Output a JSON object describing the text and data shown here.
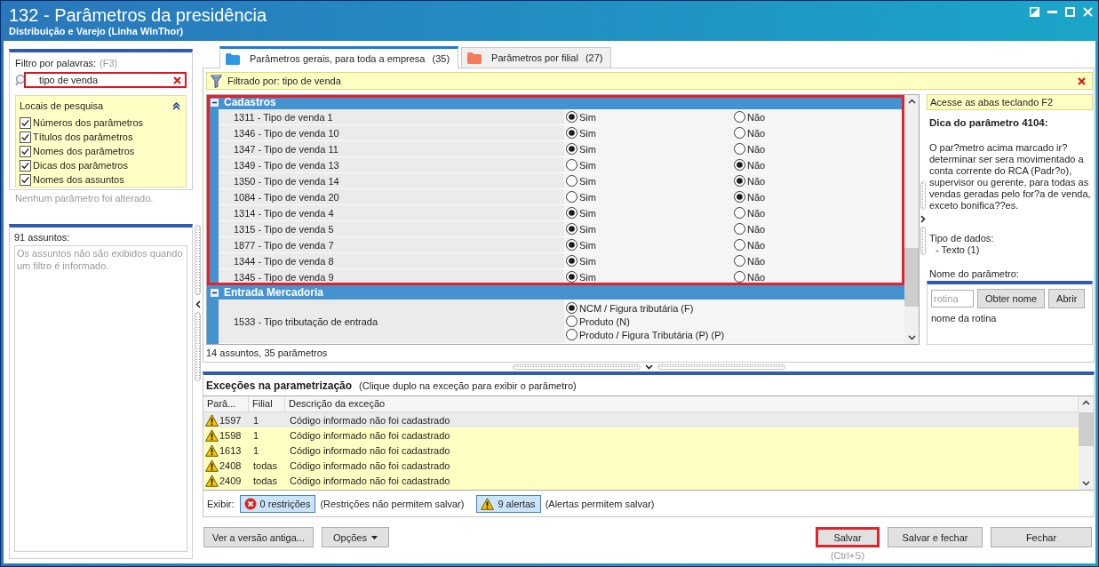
{
  "window": {
    "title": "132 - Parâmetros da presidência",
    "subtitle": "Distribuição e Varejo (Linha WinThor)"
  },
  "filter_panel": {
    "label": "Filtro por palavras:",
    "shortcut": "(F3)",
    "search": {
      "value": "tipo de venda",
      "highlighted": true
    },
    "search_locations": {
      "title": "Locais de pesquisa",
      "expanded": true,
      "options": [
        {
          "label": "Números dos parâmetros",
          "checked": true
        },
        {
          "label": "Títulos dos parâmetros",
          "checked": true
        },
        {
          "label": "Nomes dos parâmetros",
          "checked": true
        },
        {
          "label": "Dicas dos parâmetros",
          "checked": true
        },
        {
          "label": "Nomes dos assuntos",
          "checked": true
        }
      ]
    },
    "status": "Nenhum parâmetro foi alterado."
  },
  "subjects_panel": {
    "title": "91 assuntos:",
    "message": "Os assuntos não são exibidos quando um filtro é informado."
  },
  "tabs": [
    {
      "label": "Parâmetros gerais, para toda a empresa",
      "count": "(35)",
      "color": "#2b98e4",
      "selected": true
    },
    {
      "label": "Parâmetros por filial",
      "count": "(27)",
      "color": "#f47c5c",
      "selected": false
    }
  ],
  "filter_bar": {
    "text": "Filtrado por: tipo de venda"
  },
  "groups": [
    {
      "title": "Cadastros",
      "expanded": true,
      "highlighted": true,
      "rows": [
        {
          "label": "1311 - Tipo de venda 1",
          "kind": "inline",
          "options": [
            {
              "label": "Sim",
              "selected": true
            },
            {
              "label": "Não",
              "selected": false
            }
          ]
        },
        {
          "label": "1346 - Tipo de venda 10",
          "kind": "inline",
          "options": [
            {
              "label": "Sim",
              "selected": true
            },
            {
              "label": "Não",
              "selected": false
            }
          ]
        },
        {
          "label": "1347 - Tipo de venda 11",
          "kind": "inline",
          "options": [
            {
              "label": "Sim",
              "selected": true
            },
            {
              "label": "Não",
              "selected": false
            }
          ]
        },
        {
          "label": "1349 - Tipo de venda 13",
          "kind": "inline",
          "options": [
            {
              "label": "Sim",
              "selected": false
            },
            {
              "label": "Não",
              "selected": true
            }
          ]
        },
        {
          "label": "1350 - Tipo de venda 14",
          "kind": "inline",
          "options": [
            {
              "label": "Sim",
              "selected": false
            },
            {
              "label": "Não",
              "selected": true
            }
          ]
        },
        {
          "label": "1084 - Tipo de venda 20",
          "kind": "inline",
          "options": [
            {
              "label": "Sim",
              "selected": false
            },
            {
              "label": "Não",
              "selected": true
            }
          ]
        },
        {
          "label": "1314 - Tipo de venda 4",
          "kind": "inline",
          "options": [
            {
              "label": "Sim",
              "selected": true
            },
            {
              "label": "Não",
              "selected": false
            }
          ]
        },
        {
          "label": "1315 - Tipo de venda 5",
          "kind": "inline",
          "options": [
            {
              "label": "Sim",
              "selected": true
            },
            {
              "label": "Não",
              "selected": false
            }
          ]
        },
        {
          "label": "1877 - Tipo de venda 7",
          "kind": "inline",
          "options": [
            {
              "label": "Sim",
              "selected": true
            },
            {
              "label": "Não",
              "selected": false
            }
          ]
        },
        {
          "label": "1344 - Tipo de venda 8",
          "kind": "inline",
          "options": [
            {
              "label": "Sim",
              "selected": true
            },
            {
              "label": "Não",
              "selected": false
            }
          ]
        },
        {
          "label": "1345 - Tipo de venda 9",
          "kind": "inline",
          "options": [
            {
              "label": "Sim",
              "selected": true
            },
            {
              "label": "Não",
              "selected": false
            }
          ]
        }
      ]
    },
    {
      "title": "Entrada Mercadoria",
      "expanded": true,
      "highlighted": false,
      "rows": [
        {
          "label": "1533 - Tipo tributação de entrada",
          "kind": "stacked",
          "options": [
            {
              "label": "NCM / Figura tributária (F)",
              "selected": true
            },
            {
              "label": "Produto (N)",
              "selected": false
            },
            {
              "label": "Produto / Figura Tributária (P) (P)",
              "selected": false
            }
          ]
        }
      ]
    }
  ],
  "grid_status": "14 assuntos, 35 parâmetros",
  "hint_panel": {
    "banner": "Acesse as abas teclando F2",
    "title": "Dica do parâmetro 4104:",
    "text": "O par?metro acima marcado ir? determinar ser sera movimentado a conta corrente do RCA (Padr?o), supervisor ou gerente, para todas as vendas geradas pelo for?a de venda, exceto bonifica??es.",
    "data_type_label": "Tipo de dados:",
    "data_type": "- Texto (1)",
    "name_label": "Nome do parâmetro:",
    "name_field": {
      "placeholder": "rotina"
    },
    "buttons": [
      "Obter nome",
      "Abrir"
    ],
    "routine_name": "nome da rotina"
  },
  "exceptions": {
    "title": "Exceções na parametrização",
    "hint": "(Clique duplo na exceção para exibir o parâmetro)",
    "columns": [
      "Parâ...",
      "Filial",
      "Descrição da exceção"
    ],
    "rows": [
      {
        "kind": "alert",
        "param": "1597",
        "branch": "1",
        "description": "Código informado não foi cadastrado",
        "selected": true
      },
      {
        "kind": "alert",
        "param": "1598",
        "branch": "1",
        "description": "Código informado não foi cadastrado",
        "selected": false
      },
      {
        "kind": "alert",
        "param": "1613",
        "branch": "1",
        "description": "Código informado não foi cadastrado",
        "selected": false
      },
      {
        "kind": "alert",
        "param": "2408",
        "branch": "todas",
        "description": "Código informado não foi cadastrado",
        "selected": false
      },
      {
        "kind": "alert",
        "param": "2409",
        "branch": "todas",
        "description": "Código informado não foi cadastrado",
        "selected": false
      }
    ],
    "show_label": "Exibir:",
    "toggles": [
      {
        "kind": "restriction",
        "label": "0 restrições",
        "pressed": true,
        "note": "(Restrições não permitem salvar)"
      },
      {
        "kind": "alert",
        "label": "9 alertas",
        "pressed": true,
        "note": "(Alertas permitem salvar)"
      }
    ]
  },
  "footer": {
    "left_buttons": [
      {
        "label": "Ver a versão antiga...",
        "kind": "plain"
      },
      {
        "label": "Opções",
        "kind": "menu"
      }
    ],
    "right_buttons": [
      {
        "label": "Salvar",
        "highlighted": true,
        "shortcut": "(Ctrl+S)"
      },
      {
        "label": "Salvar e fechar",
        "highlighted": false
      },
      {
        "label": "Fechar",
        "highlighted": false
      }
    ]
  }
}
